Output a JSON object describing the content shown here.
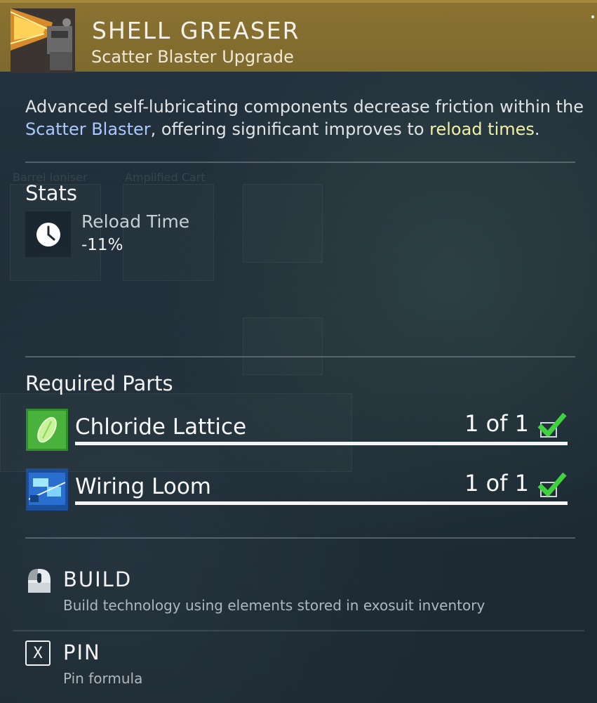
{
  "header": {
    "title": "SHELL GREASER",
    "subtitle": "Scatter Blaster Upgrade",
    "icon": "scatter-blaster-upgrade-icon"
  },
  "description": {
    "part1": "Advanced self-lubricating components decrease friction within the ",
    "highlight1": "Scatter Blaster",
    "part2": ", offering significant improves to ",
    "highlight2": "reload times",
    "part3": ".",
    "highlight1_color": "#a9c8ff",
    "highlight2_color": "#f2f0a6"
  },
  "background_ghosts": {
    "label1": "Barrel Ioniser",
    "label2": "Amplified Cart"
  },
  "stats": {
    "title": "Stats",
    "items": [
      {
        "icon": "clock-icon",
        "label": "Reload Time",
        "value": "-11%"
      }
    ]
  },
  "required_parts": {
    "title": "Required Parts",
    "items": [
      {
        "icon": "chloride-lattice-icon",
        "name": "Chloride Lattice",
        "count": "1 of 1",
        "complete": true
      },
      {
        "icon": "wiring-loom-icon",
        "name": "Wiring Loom",
        "count": "1 of 1",
        "complete": true
      }
    ]
  },
  "actions": {
    "build": {
      "icon": "mouse-button-icon",
      "label": "BUILD",
      "description": "Build technology using elements stored in exosuit inventory"
    },
    "pin": {
      "icon": "x-key-icon",
      "key": "X",
      "label": "PIN",
      "description": "Pin formula"
    }
  },
  "colors": {
    "header_bg": "#8a7232",
    "panel_bg": "#1f2d37",
    "check_green": "#3fd13f"
  }
}
